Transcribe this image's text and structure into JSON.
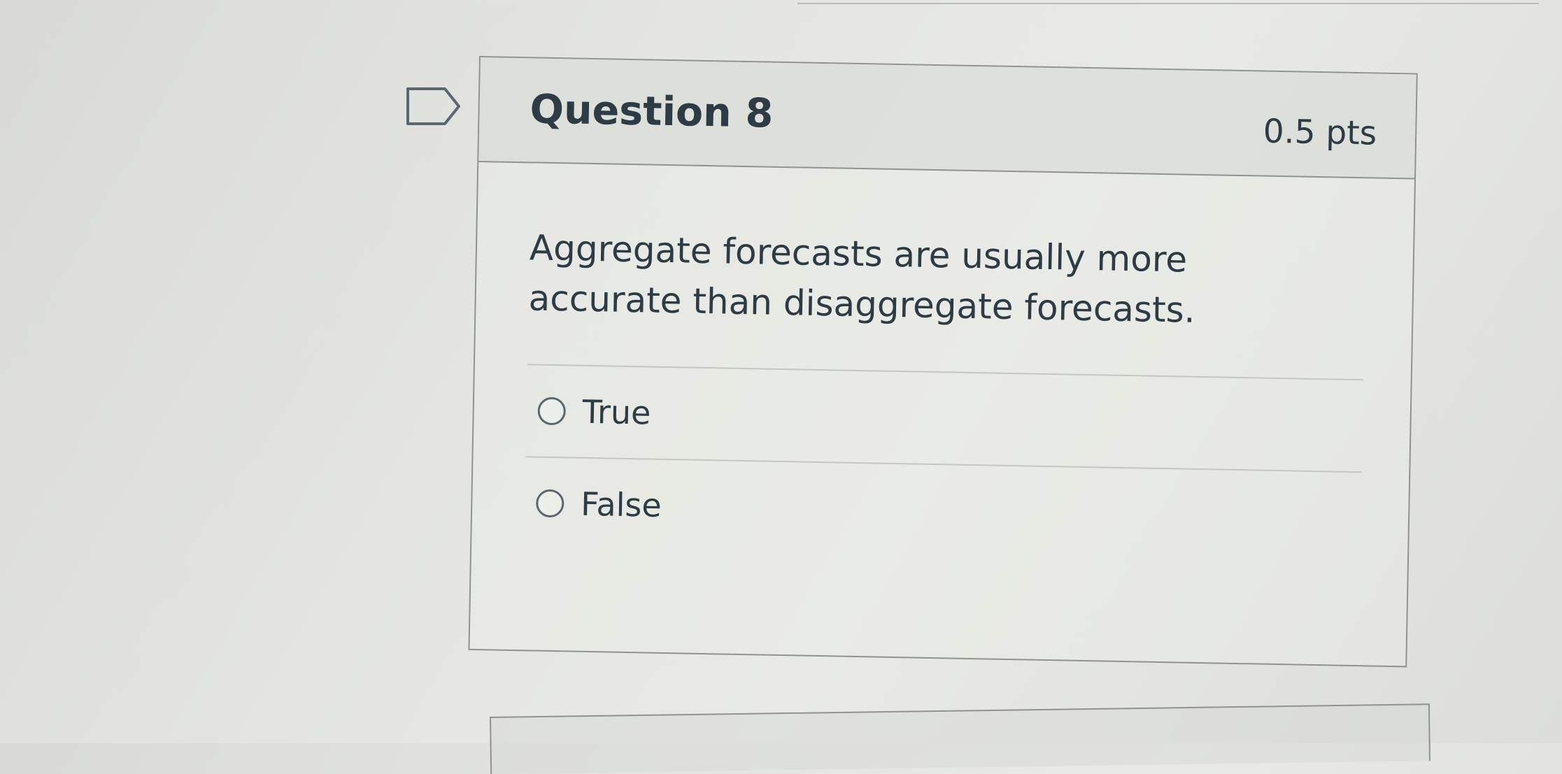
{
  "question": {
    "title": "Question 8",
    "points": "0.5 pts",
    "text": "Aggregate forecasts are usually more accurate than disaggregate forecasts.",
    "flag_icon": "flag-outline-icon",
    "answers": [
      {
        "label": "True",
        "selected": false
      },
      {
        "label": "False",
        "selected": false
      }
    ]
  },
  "colors": {
    "text": "#2d3b45",
    "border": "#8f9391",
    "header_background": "#d6d8d3"
  }
}
